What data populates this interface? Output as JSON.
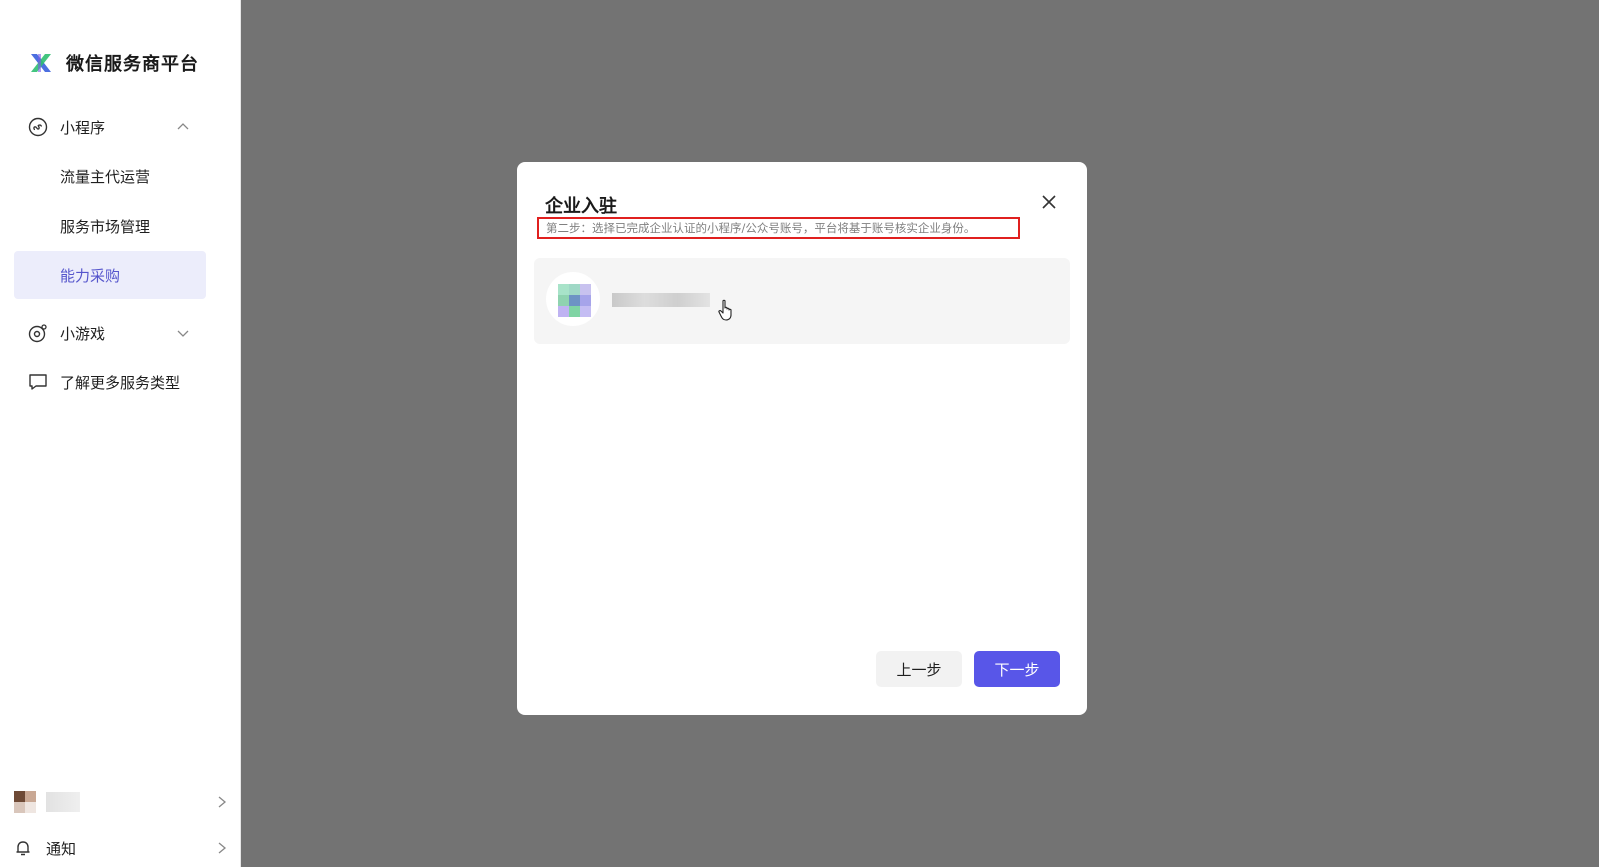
{
  "sidebar": {
    "brand": "微信服务商平台",
    "nav": [
      {
        "label": "小程序",
        "icon": "mini-program-icon",
        "expanded": true
      },
      {
        "label": "小游戏",
        "icon": "mini-game-icon",
        "expanded": false
      },
      {
        "label": "了解更多服务类型",
        "icon": "chat-bubble-icon"
      }
    ],
    "sub": [
      {
        "label": "流量主代运营",
        "active": false
      },
      {
        "label": "服务市场管理",
        "active": false
      },
      {
        "label": "能力采购",
        "active": true
      }
    ],
    "notify_label": "通知"
  },
  "modal": {
    "title": "企业入驻",
    "hint": "第二步：选择已完成企业认证的小程序/公众号账号，平台将基于账号核实企业身份。",
    "prev_label": "上一步",
    "next_label": "下一步"
  },
  "colors": {
    "accent": "#5856e8",
    "active_bg": "#ecedfb",
    "active_text": "#5555cc",
    "highlight_border": "#e0201f",
    "overlay": "#737373"
  }
}
